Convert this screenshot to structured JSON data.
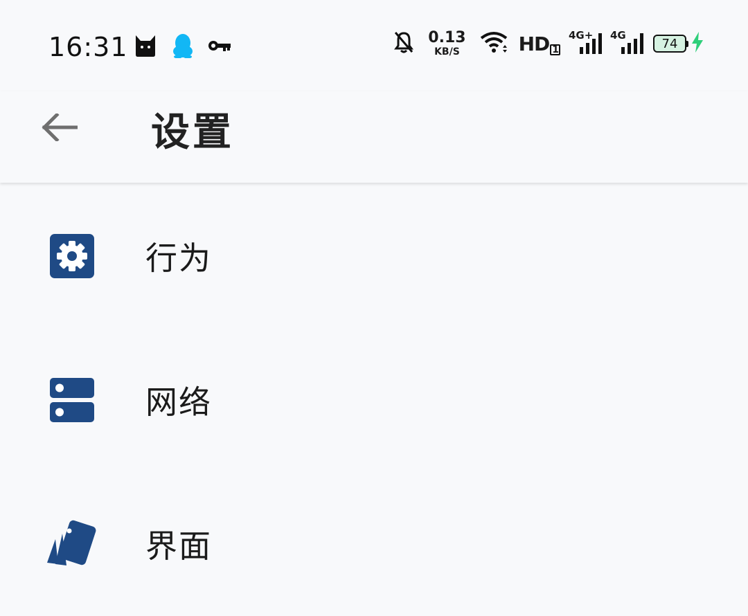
{
  "status_bar": {
    "time": "16:31",
    "left_icons": [
      "cat-icon",
      "qq-penguin-icon",
      "key-icon"
    ],
    "net_speed_value": "0.13",
    "net_speed_unit": "KB/S",
    "hd_label": "HD",
    "hd_sub": "1",
    "sim1_tag": "4G+",
    "sim2_tag": "4G",
    "battery_level": "74",
    "battery_charging": true,
    "charge_color": "#2ecf7a",
    "qq_color": "#12b7f5"
  },
  "app_bar": {
    "back_icon": "arrow-left-icon",
    "title": "设置"
  },
  "accent_color": "#1f4a85",
  "settings": [
    {
      "icon": "gear-icon",
      "label": "行为"
    },
    {
      "icon": "server-icon",
      "label": "网络"
    },
    {
      "icon": "palette-cards-icon",
      "label": "界面"
    }
  ]
}
